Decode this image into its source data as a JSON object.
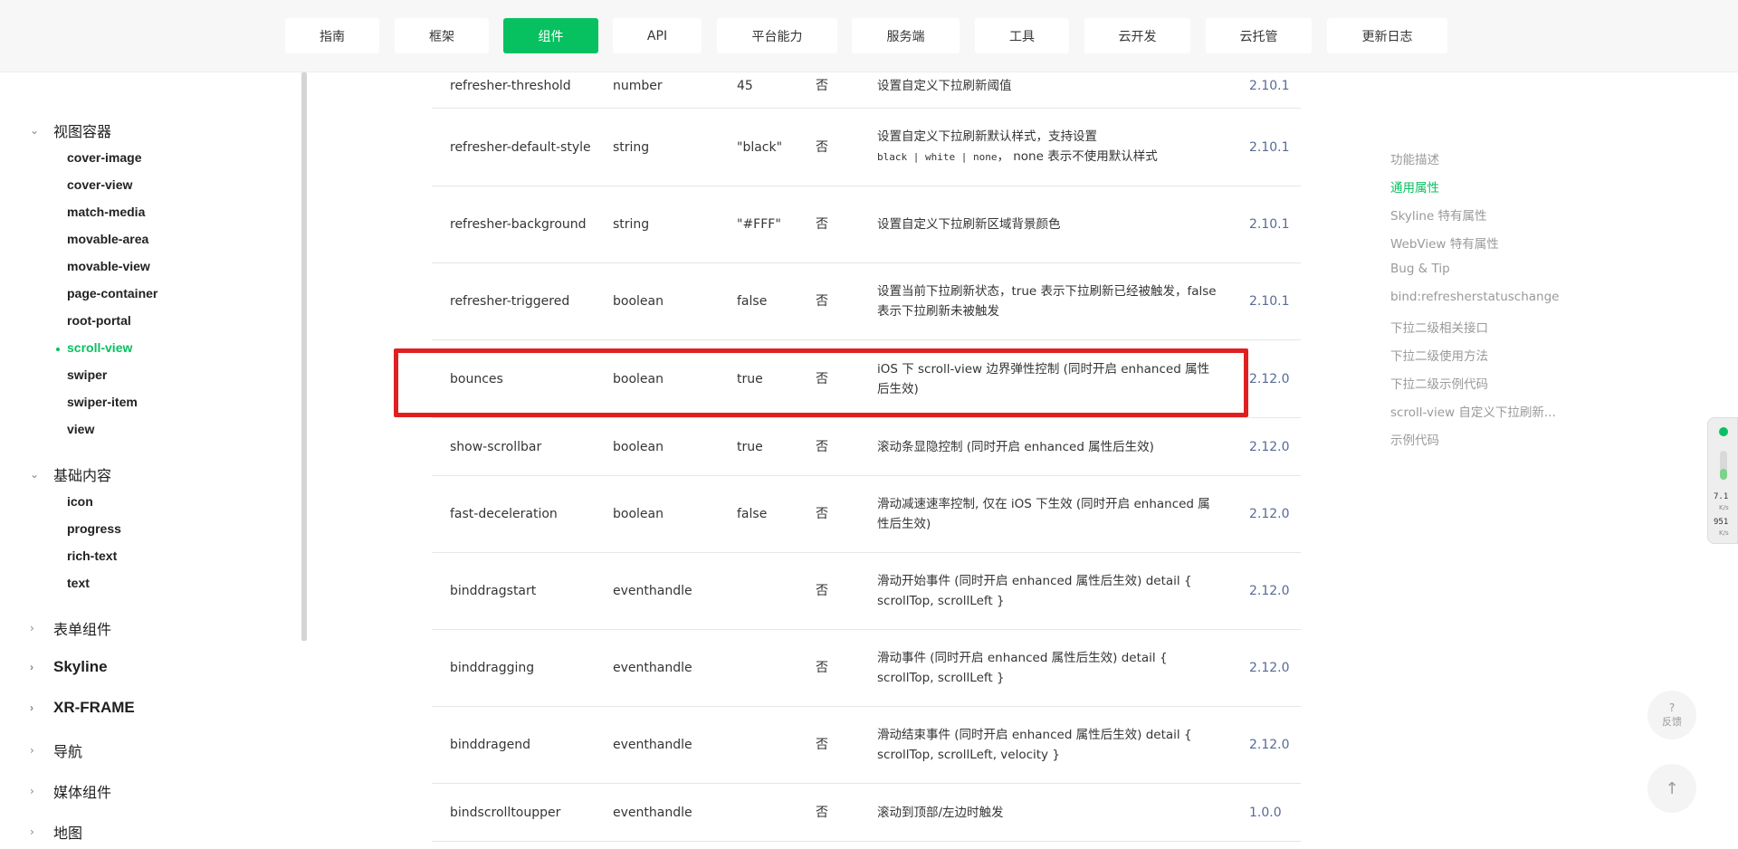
{
  "topnav": {
    "items": [
      {
        "label": "指南"
      },
      {
        "label": "框架"
      },
      {
        "label": "组件",
        "active": true
      },
      {
        "label": "API"
      },
      {
        "label": "平台能力"
      },
      {
        "label": "服务端"
      },
      {
        "label": "工具"
      },
      {
        "label": "云开发"
      },
      {
        "label": "云托管"
      },
      {
        "label": "更新日志"
      }
    ]
  },
  "sidebar": {
    "group1": "视图容器",
    "group1_items": [
      "cover-image",
      "cover-view",
      "match-media",
      "movable-area",
      "movable-view",
      "page-container",
      "root-portal",
      "scroll-view",
      "swiper",
      "swiper-item",
      "view"
    ],
    "group2": "基础内容",
    "group2_items": [
      "icon",
      "progress",
      "rich-text",
      "text"
    ],
    "collapsed_groups": [
      "表单组件",
      "Skyline",
      "XR-FRAME",
      "导航",
      "媒体组件",
      "地图"
    ]
  },
  "table": {
    "rows": [
      {
        "name": "refresher-threshold",
        "type": "number",
        "default": "45",
        "required": "否",
        "desc": "设置自定义下拉刷新阈值",
        "version": "2.10.1"
      },
      {
        "name": "refresher-default-style",
        "type": "string",
        "default": "\"black\"",
        "required": "否",
        "desc": "设置自定义下拉刷新默认样式，支持设置",
        "desc_code": "black | white | none",
        "desc_tail": "， none 表示不使用默认样式",
        "version": "2.10.1"
      },
      {
        "name": "refresher-background",
        "type": "string",
        "default": "\"#FFF\"",
        "required": "否",
        "desc": "设置自定义下拉刷新区域背景颜色",
        "version": "2.10.1"
      },
      {
        "name": "refresher-triggered",
        "type": "boolean",
        "default": "false",
        "required": "否",
        "desc": "设置当前下拉刷新状态，true 表示下拉刷新已经被触发，false 表示下拉刷新未被触发",
        "version": "2.10.1"
      },
      {
        "name": "bounces",
        "type": "boolean",
        "default": "true",
        "required": "否",
        "desc": "iOS 下 scroll-view 边界弹性控制 (同时开启 enhanced 属性后生效)",
        "version": "2.12.0"
      },
      {
        "name": "show-scrollbar",
        "type": "boolean",
        "default": "true",
        "required": "否",
        "desc": "滚动条显隐控制 (同时开启 enhanced 属性后生效)",
        "version": "2.12.0"
      },
      {
        "name": "fast-deceleration",
        "type": "boolean",
        "default": "false",
        "required": "否",
        "desc": "滑动减速速率控制, 仅在 iOS 下生效 (同时开启 enhanced 属性后生效)",
        "version": "2.12.0"
      },
      {
        "name": "binddragstart",
        "type": "eventhandle",
        "default": "",
        "required": "否",
        "desc": "滑动开始事件 (同时开启 enhanced 属性后生效) detail { scrollTop, scrollLeft }",
        "version": "2.12.0"
      },
      {
        "name": "binddragging",
        "type": "eventhandle",
        "default": "",
        "required": "否",
        "desc": "滑动事件 (同时开启 enhanced 属性后生效) detail { scrollTop, scrollLeft }",
        "version": "2.12.0"
      },
      {
        "name": "binddragend",
        "type": "eventhandle",
        "default": "",
        "required": "否",
        "desc": "滑动结束事件 (同时开启 enhanced 属性后生效) detail { scrollTop, scrollLeft, velocity }",
        "version": "2.12.0"
      },
      {
        "name": "bindscrolltoupper",
        "type": "eventhandle",
        "default": "",
        "required": "否",
        "desc": "滚动到顶部/左边时触发",
        "version": "1.0.0"
      }
    ]
  },
  "toc": {
    "items": [
      "功能描述",
      "通用属性",
      "Skyline 特有属性",
      "WebView 特有属性",
      "Bug & Tip",
      "bind:refresherstatuschange",
      "下拉二级相关接口",
      "下拉二级使用方法",
      "下拉二级示例代码",
      "scroll-view 自定义下拉刷新...",
      "示例代码"
    ],
    "active": "通用属性"
  },
  "widget": {
    "upload": "7.1",
    "upload_unit": "K/s",
    "download": "951",
    "download_unit": "K/s"
  },
  "feedback": {
    "icon": "?",
    "label": "反馈"
  },
  "colors": {
    "accent": "#07c160",
    "highlight": "#e02020",
    "link": "#576b95"
  }
}
